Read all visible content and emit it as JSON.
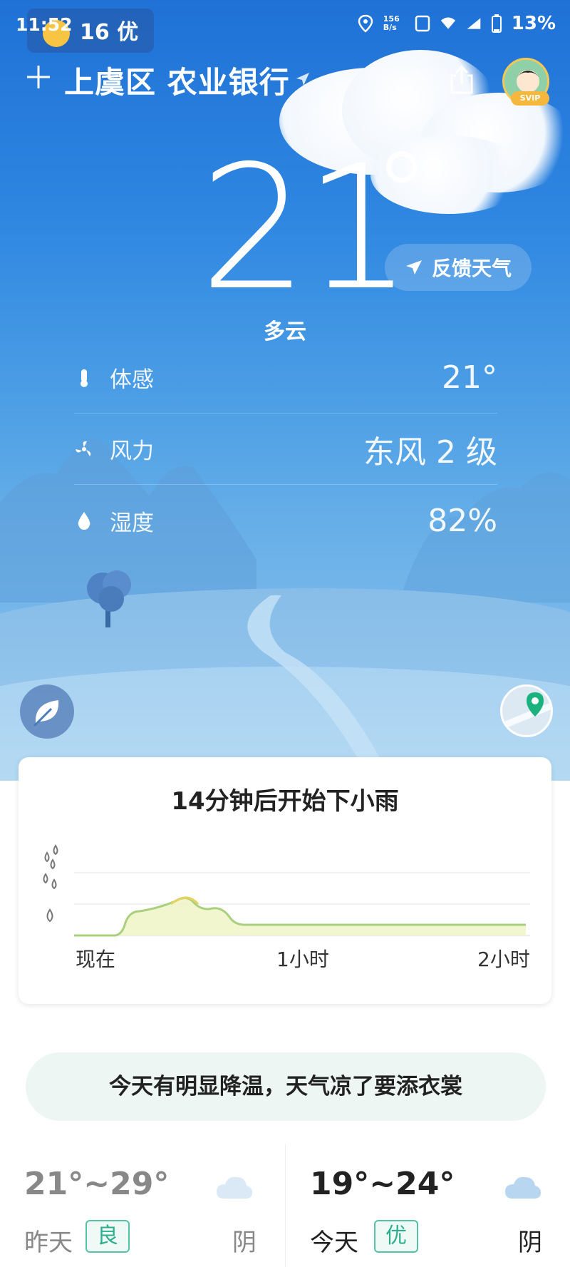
{
  "status_bar": {
    "time": "11:52",
    "aqi": "16 优",
    "net_speed": "156 B/s",
    "battery": "13%"
  },
  "header": {
    "city": "上虞区 农业银行",
    "vip_badge": "SVIP"
  },
  "current": {
    "temperature": "21",
    "condition": "多云",
    "feedback_label": "反馈天气"
  },
  "details": [
    {
      "icon": "thermometer-icon",
      "label": "体感",
      "value": "21°"
    },
    {
      "icon": "wind-icon",
      "label": "风力",
      "value": "东风 2 级"
    },
    {
      "icon": "humidity-icon",
      "label": "湿度",
      "value": "82%"
    }
  ],
  "rain": {
    "title": "14分钟后开始下小雨",
    "axis": [
      "现在",
      "1小时",
      "2小时"
    ],
    "colors": {
      "line": "#9cc978",
      "fill": "#eef5c7",
      "peak": "#e4d35f"
    }
  },
  "tip": "今天有明显降温，天气凉了要添衣裳",
  "forecast": [
    {
      "range": "21°~29°",
      "day": "昨天",
      "aqi": "良",
      "condition": "阴",
      "dim": true
    },
    {
      "range": "19°~24°",
      "day": "今天",
      "aqi": "优",
      "condition": "阴",
      "dim": false
    }
  ]
}
